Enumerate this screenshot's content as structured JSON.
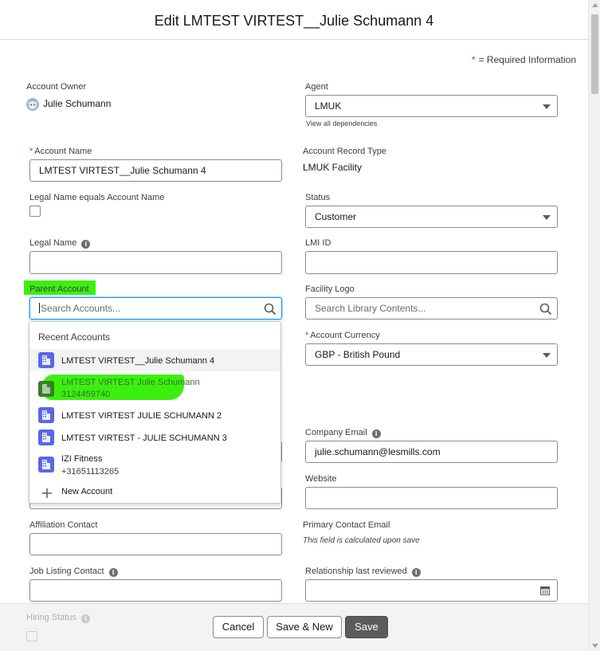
{
  "modal": {
    "title": "Edit LMTEST VIRTEST__Julie Schumann 4",
    "required_note": "= Required Information",
    "required_star": "*"
  },
  "fields": {
    "account_owner": {
      "label": "Account Owner",
      "value": "Julie Schumann"
    },
    "agent": {
      "label": "Agent",
      "value": "LMUK",
      "link": "View all dependencies"
    },
    "account_name": {
      "label": "Account Name",
      "value": "LMTEST VIRTEST__Julie Schumann 4"
    },
    "account_record_type": {
      "label": "Account Record Type",
      "value": "LMUK Facility"
    },
    "legal_name_equals": {
      "label": "Legal Name equals Account Name",
      "checked": false
    },
    "status": {
      "label": "Status",
      "value": "Customer"
    },
    "legal_name": {
      "label": "Legal Name",
      "value": ""
    },
    "lmi_id": {
      "label": "LMI ID",
      "value": ""
    },
    "parent_account": {
      "label": "Parent Account",
      "placeholder": "Search Accounts..."
    },
    "facility_logo": {
      "label": "Facility Logo",
      "placeholder": "Search Library Contents..."
    },
    "account_currency": {
      "label": "Account Currency",
      "value": "GBP - British Pound"
    },
    "company_email": {
      "label": "Company Email",
      "value": "julie.schumann@lesmills.com"
    },
    "website": {
      "label": "Website",
      "value": ""
    },
    "affiliation_contact": {
      "label": "Affiliation Contact",
      "value": ""
    },
    "primary_contact_email": {
      "label": "Primary Contact Email",
      "value": "This field is calculated upon save"
    },
    "job_listing_contact": {
      "label": "Job Listing Contact",
      "value": ""
    },
    "relationship_last_reviewed": {
      "label": "Relationship last reviewed",
      "value": ""
    },
    "hiring_status": {
      "label": "Hiring Status"
    }
  },
  "dropdown": {
    "heading": "Recent Accounts",
    "items": [
      {
        "name": "LMTEST VIRTEST__Julie Schumann 4",
        "sub": ""
      },
      {
        "name": "LMTEST VIRTEST Julie Schumann",
        "sub": "3124459740"
      },
      {
        "name": "LMTEST VIRTEST JULIE SCHUMANN 2",
        "sub": ""
      },
      {
        "name": "LMTEST VIRTEST - JULIE SCHUMANN 3",
        "sub": ""
      },
      {
        "name": "IZI Fitness",
        "sub": "+31651113265"
      }
    ],
    "new_label": "New Account"
  },
  "footer": {
    "cancel": "Cancel",
    "save_new": "Save & New",
    "save": "Save"
  },
  "colors": {
    "highlight": "#3bf00f",
    "account_icon": "#5867e8",
    "required": "#c23934",
    "save_button": "#5b5b5b"
  },
  "icons": [
    "avatar-icon",
    "search-icon",
    "account-icon",
    "plus-icon",
    "calendar-icon",
    "info-icon"
  ]
}
